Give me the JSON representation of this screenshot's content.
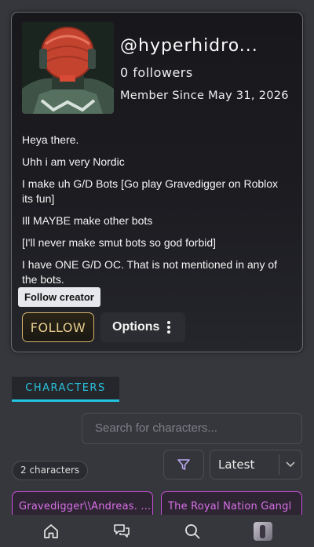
{
  "profile": {
    "username": "@hyperhidro...",
    "followers": "0 followers",
    "member_since": "Member Since May 31, 2026",
    "bio": [
      "Heya there.",
      "Uhh i am very Nordic",
      "I make uh G/D Bots [Go play Gravedigger on Roblox its fun]",
      "Ill MAYBE make other bots",
      "[I'll never make smut bots so god forbid]",
      "I have ONE G/D OC. That is not mentioned in any of the bots."
    ],
    "tooltip": "Follow creator",
    "follow_label": "FOLLOW",
    "options_label": "Options"
  },
  "tabs": {
    "characters": "CHARACTERS"
  },
  "search": {
    "placeholder": "Search for characters..."
  },
  "filters": {
    "count": "2 characters",
    "sort_selected": "Latest"
  },
  "characters": [
    {
      "name": "Gravedigger\\\\Andreas. ..."
    },
    {
      "name": "The Royal Nation Gangl"
    }
  ],
  "colors": {
    "accent_cyan": "#22c5e0",
    "follow_gold": "#d7b56d",
    "card_pink": "#c54fd8"
  },
  "nav": {
    "icons": [
      "home-icon",
      "chat-icon",
      "search-icon",
      "profile-avatar"
    ]
  }
}
